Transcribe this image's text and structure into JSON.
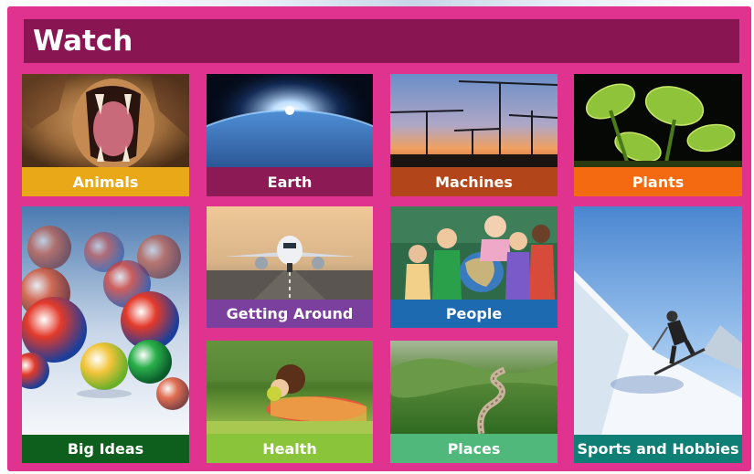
{
  "header": {
    "title": "Watch"
  },
  "tiles": {
    "animals": {
      "label": "Animals",
      "color": "#e8a818",
      "image": "roaring-lion"
    },
    "earth": {
      "label": "Earth",
      "color": "#8c1a55",
      "image": "planet-earth-sunrise"
    },
    "machines": {
      "label": "Machines",
      "color": "#b2461a",
      "image": "construction-cranes-sunset"
    },
    "plants": {
      "label": "Plants",
      "color": "#f36a10",
      "image": "venus-flytrap"
    },
    "big_ideas": {
      "label": "Big Ideas",
      "color": "#0e5e1e",
      "image": "glass-marbles"
    },
    "getting_around": {
      "label": "Getting Around",
      "color": "#7b3f9e",
      "image": "airplane-on-runway"
    },
    "people": {
      "label": "People",
      "color": "#1d6ab0",
      "image": "children-with-globe"
    },
    "sports": {
      "label": "Sports and Hobbies",
      "color": "#0f7f76",
      "image": "skier-on-slope"
    },
    "health": {
      "label": "Health",
      "color": "#8ac43a",
      "image": "girl-eating-apple"
    },
    "places": {
      "label": "Places",
      "color": "#4fb87a",
      "image": "great-wall"
    }
  }
}
